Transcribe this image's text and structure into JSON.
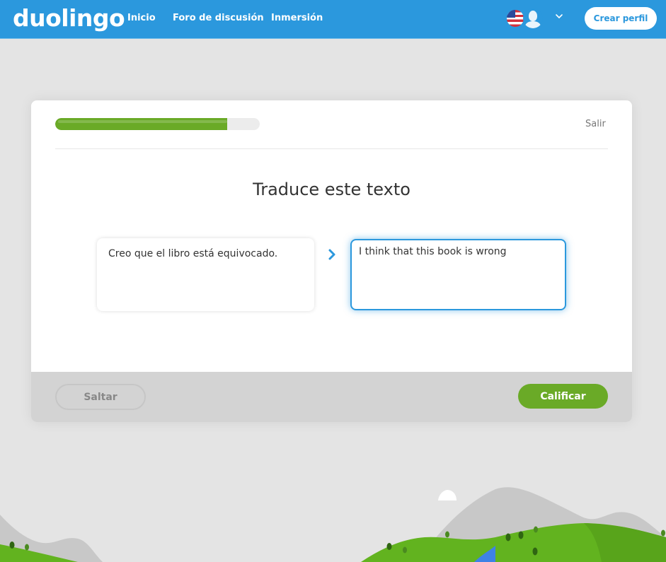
{
  "header": {
    "logo": "duolingo",
    "nav": [
      {
        "label": "Inicio"
      },
      {
        "label": "Foro de discusión"
      },
      {
        "label": "Inmersión"
      }
    ],
    "language_flag_icon": "us-flag-icon",
    "avatar_icon": "user-avatar-icon",
    "menu_icon": "chevron-down-icon",
    "create_profile_label": "Crear perfil"
  },
  "lesson": {
    "progress_fraction": 0.84,
    "quit_label": "Salir",
    "prompt_title": "Traduce este texto",
    "source_text": "Creo que el libro está equivocado.",
    "arrow_icon": "chevron-right-icon",
    "answer_value": "I think that this book is wrong",
    "skip_label": "Saltar",
    "check_label": "Calificar"
  },
  "colors": {
    "brand_blue": "#2b98dd",
    "progress_green": "#6aaa27",
    "check_green": "#6aaa27",
    "footer_gray": "#d3d3d3",
    "background": "#e4e4e4"
  }
}
